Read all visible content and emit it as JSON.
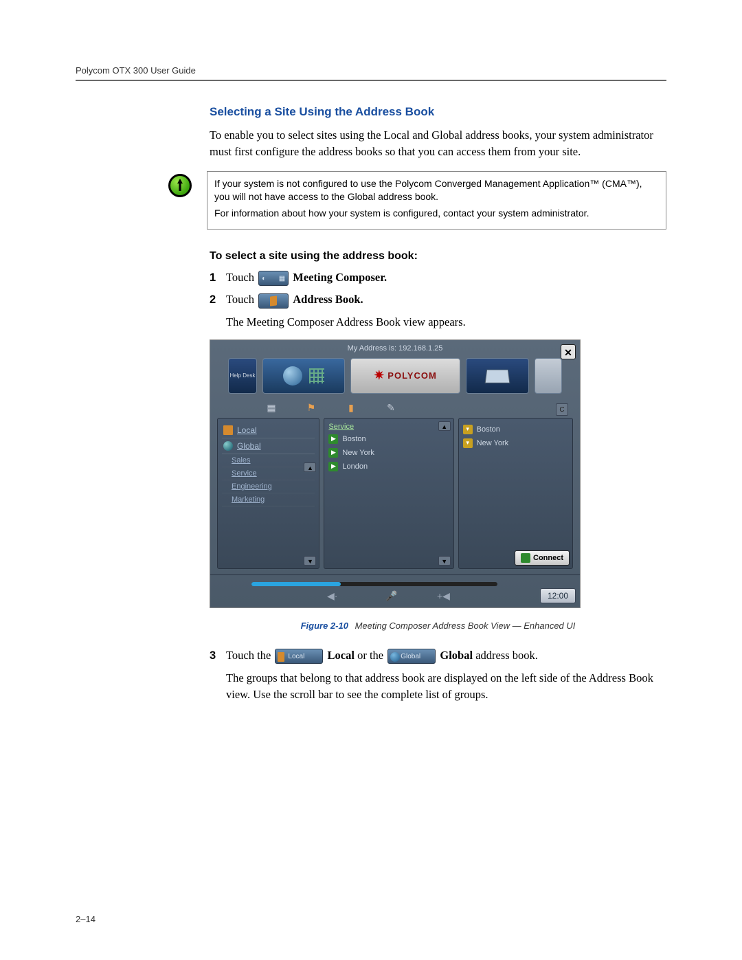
{
  "running_header": "Polycom OTX 300 User Guide",
  "section_heading": "Selecting a Site Using the Address Book",
  "intro": "To enable you to select sites using the Local and Global address books, your system administrator must first configure the address books so that you can access them from your site.",
  "note": {
    "p1": "If your system is not configured to use the Polycom Converged Management Application™ (CMA™), you will not have access to the Global address book.",
    "p2": "For information about how your system is configured, contact your system administrator."
  },
  "procedure_heading": "To select a site using the address book:",
  "steps": {
    "s1_num": "1",
    "s1_a": "Touch ",
    "s1_b": " Meeting Composer.",
    "s2_num": "2",
    "s2_a": "Touch ",
    "s2_b": " Address Book.",
    "s2_result": "The Meeting Composer Address Book view appears.",
    "s3_num": "3",
    "s3_a": "Touch the ",
    "s3_local": " Local",
    "s3_mid": " or the ",
    "s3_global": " Global",
    "s3_b": " address book.",
    "s3_result": "The groups that belong to that address book are displayed on the left side of the Address Book view. Use the scroll bar to see the complete list of groups."
  },
  "inline_labels": {
    "local": "Local",
    "global": "Global"
  },
  "screenshot": {
    "close": "✕",
    "my_address": "My Address is: 192.168.1.25",
    "tiles": {
      "helpdesk": "Help Desk",
      "logo": "POLYCOM"
    },
    "left": {
      "local": "Local",
      "global": "Global",
      "groups": [
        "Sales",
        "Service",
        "Engineering",
        "Marketing"
      ]
    },
    "mid": {
      "header": "Service",
      "items": [
        "Boston",
        "New York",
        "London"
      ]
    },
    "right": {
      "c": "C",
      "items": [
        "Boston",
        "New York"
      ],
      "connect": "Connect"
    },
    "time": "12:00"
  },
  "figure": {
    "num": "Figure 2-10",
    "title": "Meeting Composer Address Book View — Enhanced UI"
  },
  "page_number": "2–14"
}
